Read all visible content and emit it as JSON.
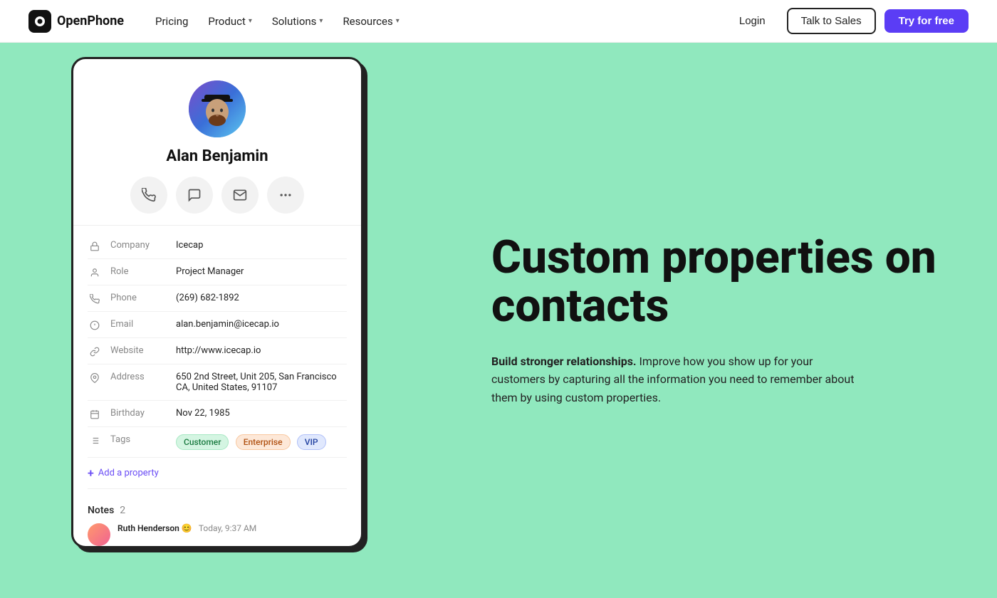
{
  "navbar": {
    "logo_text": "OpenPhone",
    "nav_links": [
      {
        "label": "Pricing",
        "has_dropdown": false
      },
      {
        "label": "Product",
        "has_dropdown": true
      },
      {
        "label": "Solutions",
        "has_dropdown": true
      },
      {
        "label": "Resources",
        "has_dropdown": true
      }
    ],
    "login_label": "Login",
    "talk_label": "Talk to Sales",
    "try_label": "Try for free"
  },
  "contact": {
    "name": "Alan Benjamin",
    "company": "Icecap",
    "role": "Project Manager",
    "phone": "(269) 682-1892",
    "email": "alan.benjamin@icecap.io",
    "website": "http://www.icecap.io",
    "address": "650 2nd Street, Unit 205, San Francisco CA, United States, 91107",
    "birthday": "Nov 22, 1985",
    "tags": [
      "Customer",
      "Enterprise",
      "VIP"
    ]
  },
  "contact_fields": {
    "company_label": "Company",
    "role_label": "Role",
    "phone_label": "Phone",
    "email_label": "Email",
    "website_label": "Website",
    "address_label": "Address",
    "birthday_label": "Birthday",
    "tags_label": "Tags"
  },
  "add_property_label": "Add a property",
  "notes": {
    "label": "Notes",
    "count": "2",
    "first_author": "Ruth Henderson",
    "first_emoji": "😊",
    "first_time": "Today, 9:37 AM"
  },
  "hero": {
    "title": "Custom properties on contacts",
    "desc_bold": "Build stronger relationships.",
    "desc_rest": " Improve how you show up for your customers by capturing all the information you need to remember about them by using custom properties."
  }
}
